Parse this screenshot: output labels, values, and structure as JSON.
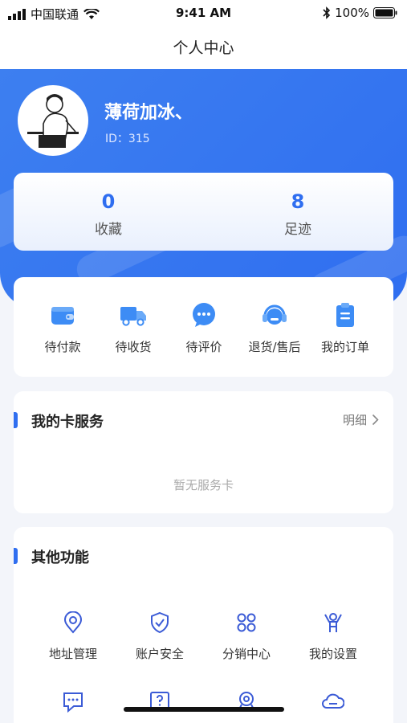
{
  "status_bar": {
    "carrier": "中国联通",
    "time": "9:41 AM",
    "battery": "100%"
  },
  "nav": {
    "title": "个人中心"
  },
  "profile": {
    "name": "薄荷加冰、",
    "id_text": "ID：315"
  },
  "stats": [
    {
      "value": "0",
      "label": "收藏"
    },
    {
      "value": "8",
      "label": "足迹"
    }
  ],
  "orders": [
    {
      "label": "待付款",
      "icon": "wallet-icon"
    },
    {
      "label": "待收货",
      "icon": "truck-icon"
    },
    {
      "label": "待评价",
      "icon": "chat-bubble-icon"
    },
    {
      "label": "退货/售后",
      "icon": "headset-icon"
    },
    {
      "label": "我的订单",
      "icon": "clipboard-icon"
    }
  ],
  "card_service": {
    "title": "我的卡服务",
    "more_label": "明细",
    "empty_text": "暂无服务卡"
  },
  "other_functions": {
    "title": "其他功能",
    "items": [
      {
        "label": "地址管理",
        "icon": "location-pin-icon"
      },
      {
        "label": "账户安全",
        "icon": "shield-check-icon"
      },
      {
        "label": "分销中心",
        "icon": "grid-apps-icon"
      },
      {
        "label": "我的设置",
        "icon": "person-settings-icon"
      },
      {
        "label": "",
        "icon": "message-icon"
      },
      {
        "label": "",
        "icon": "help-icon"
      },
      {
        "label": "",
        "icon": "map-marker-icon"
      },
      {
        "label": "",
        "icon": "cloud-icon"
      }
    ]
  },
  "colors": {
    "primary": "#2f6ef0",
    "icon_blue": "#3d8cf5",
    "background": "#f3f5fa"
  }
}
